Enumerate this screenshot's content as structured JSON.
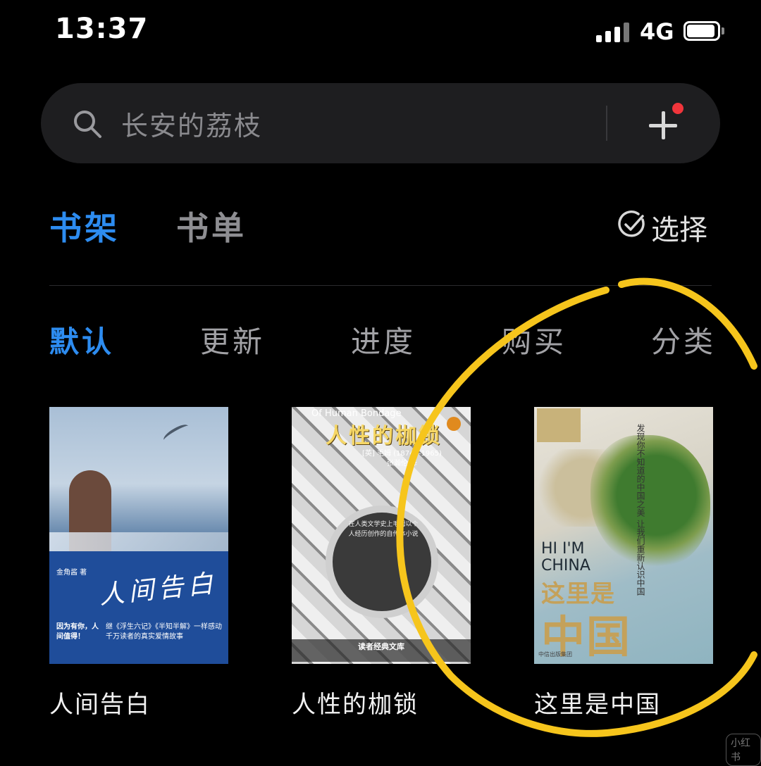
{
  "status_bar": {
    "time": "13:37",
    "network": "4G"
  },
  "search": {
    "text": "长安的荔枝"
  },
  "main_tabs": [
    {
      "label": "书架",
      "active": true
    },
    {
      "label": "书单",
      "active": false
    }
  ],
  "select_label": "选择",
  "sort_tabs": [
    {
      "label": "默认",
      "active": true
    },
    {
      "label": "更新",
      "active": false
    },
    {
      "label": "进度",
      "active": false
    },
    {
      "label": "购买",
      "active": false
    },
    {
      "label": "分类",
      "active": false
    }
  ],
  "books": [
    {
      "title": "人间告白",
      "cover": {
        "title_art": "人间告白",
        "author": "金角酱 著",
        "tagline": "因为有你，人间值得！",
        "blurb": "继《浮生六记》《半知半解》一样感动千万读者的真实爱情故事"
      }
    },
    {
      "title": "人性的枷锁",
      "cover": {
        "english_title": "Of Human Bondage",
        "title_art": "人性的枷锁",
        "author": "[英] 毛姆 (1874—1965)",
        "translator": "张瀚伦 译",
        "blurb": "在人类文学史上毛姆以个人经历创作的自传体小说",
        "series": "读者经典文库"
      }
    },
    {
      "title": "这里是中国",
      "cover": {
        "vertical_text": "发现你不知道的中国之美 让我们重新认识中国",
        "english_title": "HI I'M CHINA",
        "title_line1": "这里是",
        "title_line2": "中国",
        "publisher": "中信出版集团"
      }
    }
  ],
  "watermark": "小红书",
  "colors": {
    "accent": "#2d8cf0",
    "highlight": "#f6c51c",
    "background": "#000000"
  }
}
